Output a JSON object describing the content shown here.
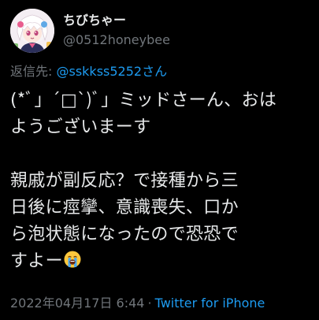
{
  "user": {
    "display_name": "ちびちゃー",
    "handle": "@0512honeybee",
    "avatar_icon": "avatar-anime-girl-icon"
  },
  "reply": {
    "prefix": "返信先: ",
    "mention": "@sskkss5252さん"
  },
  "tweet": {
    "line_1": "(*ﾞ」´□`)ﾞ」ミッドさーん、おは",
    "line_2": "ようございまーす",
    "line_3": "",
    "line_4": "親戚が副反応？で接種から三",
    "line_5": "日後に痙攣、意識喪失、口か",
    "line_6": "ら泡状態になったので恐恐で",
    "line_7": "すよー",
    "emoji": "loudly-crying-face-icon"
  },
  "meta": {
    "timestamp": "2022年04月17日 6:44",
    "separator": "·",
    "source": "Twitter for iPhone"
  },
  "colors": {
    "background": "#000000",
    "text": "#e7e9ea",
    "muted": "#71767b",
    "link": "#1d9bf0"
  }
}
